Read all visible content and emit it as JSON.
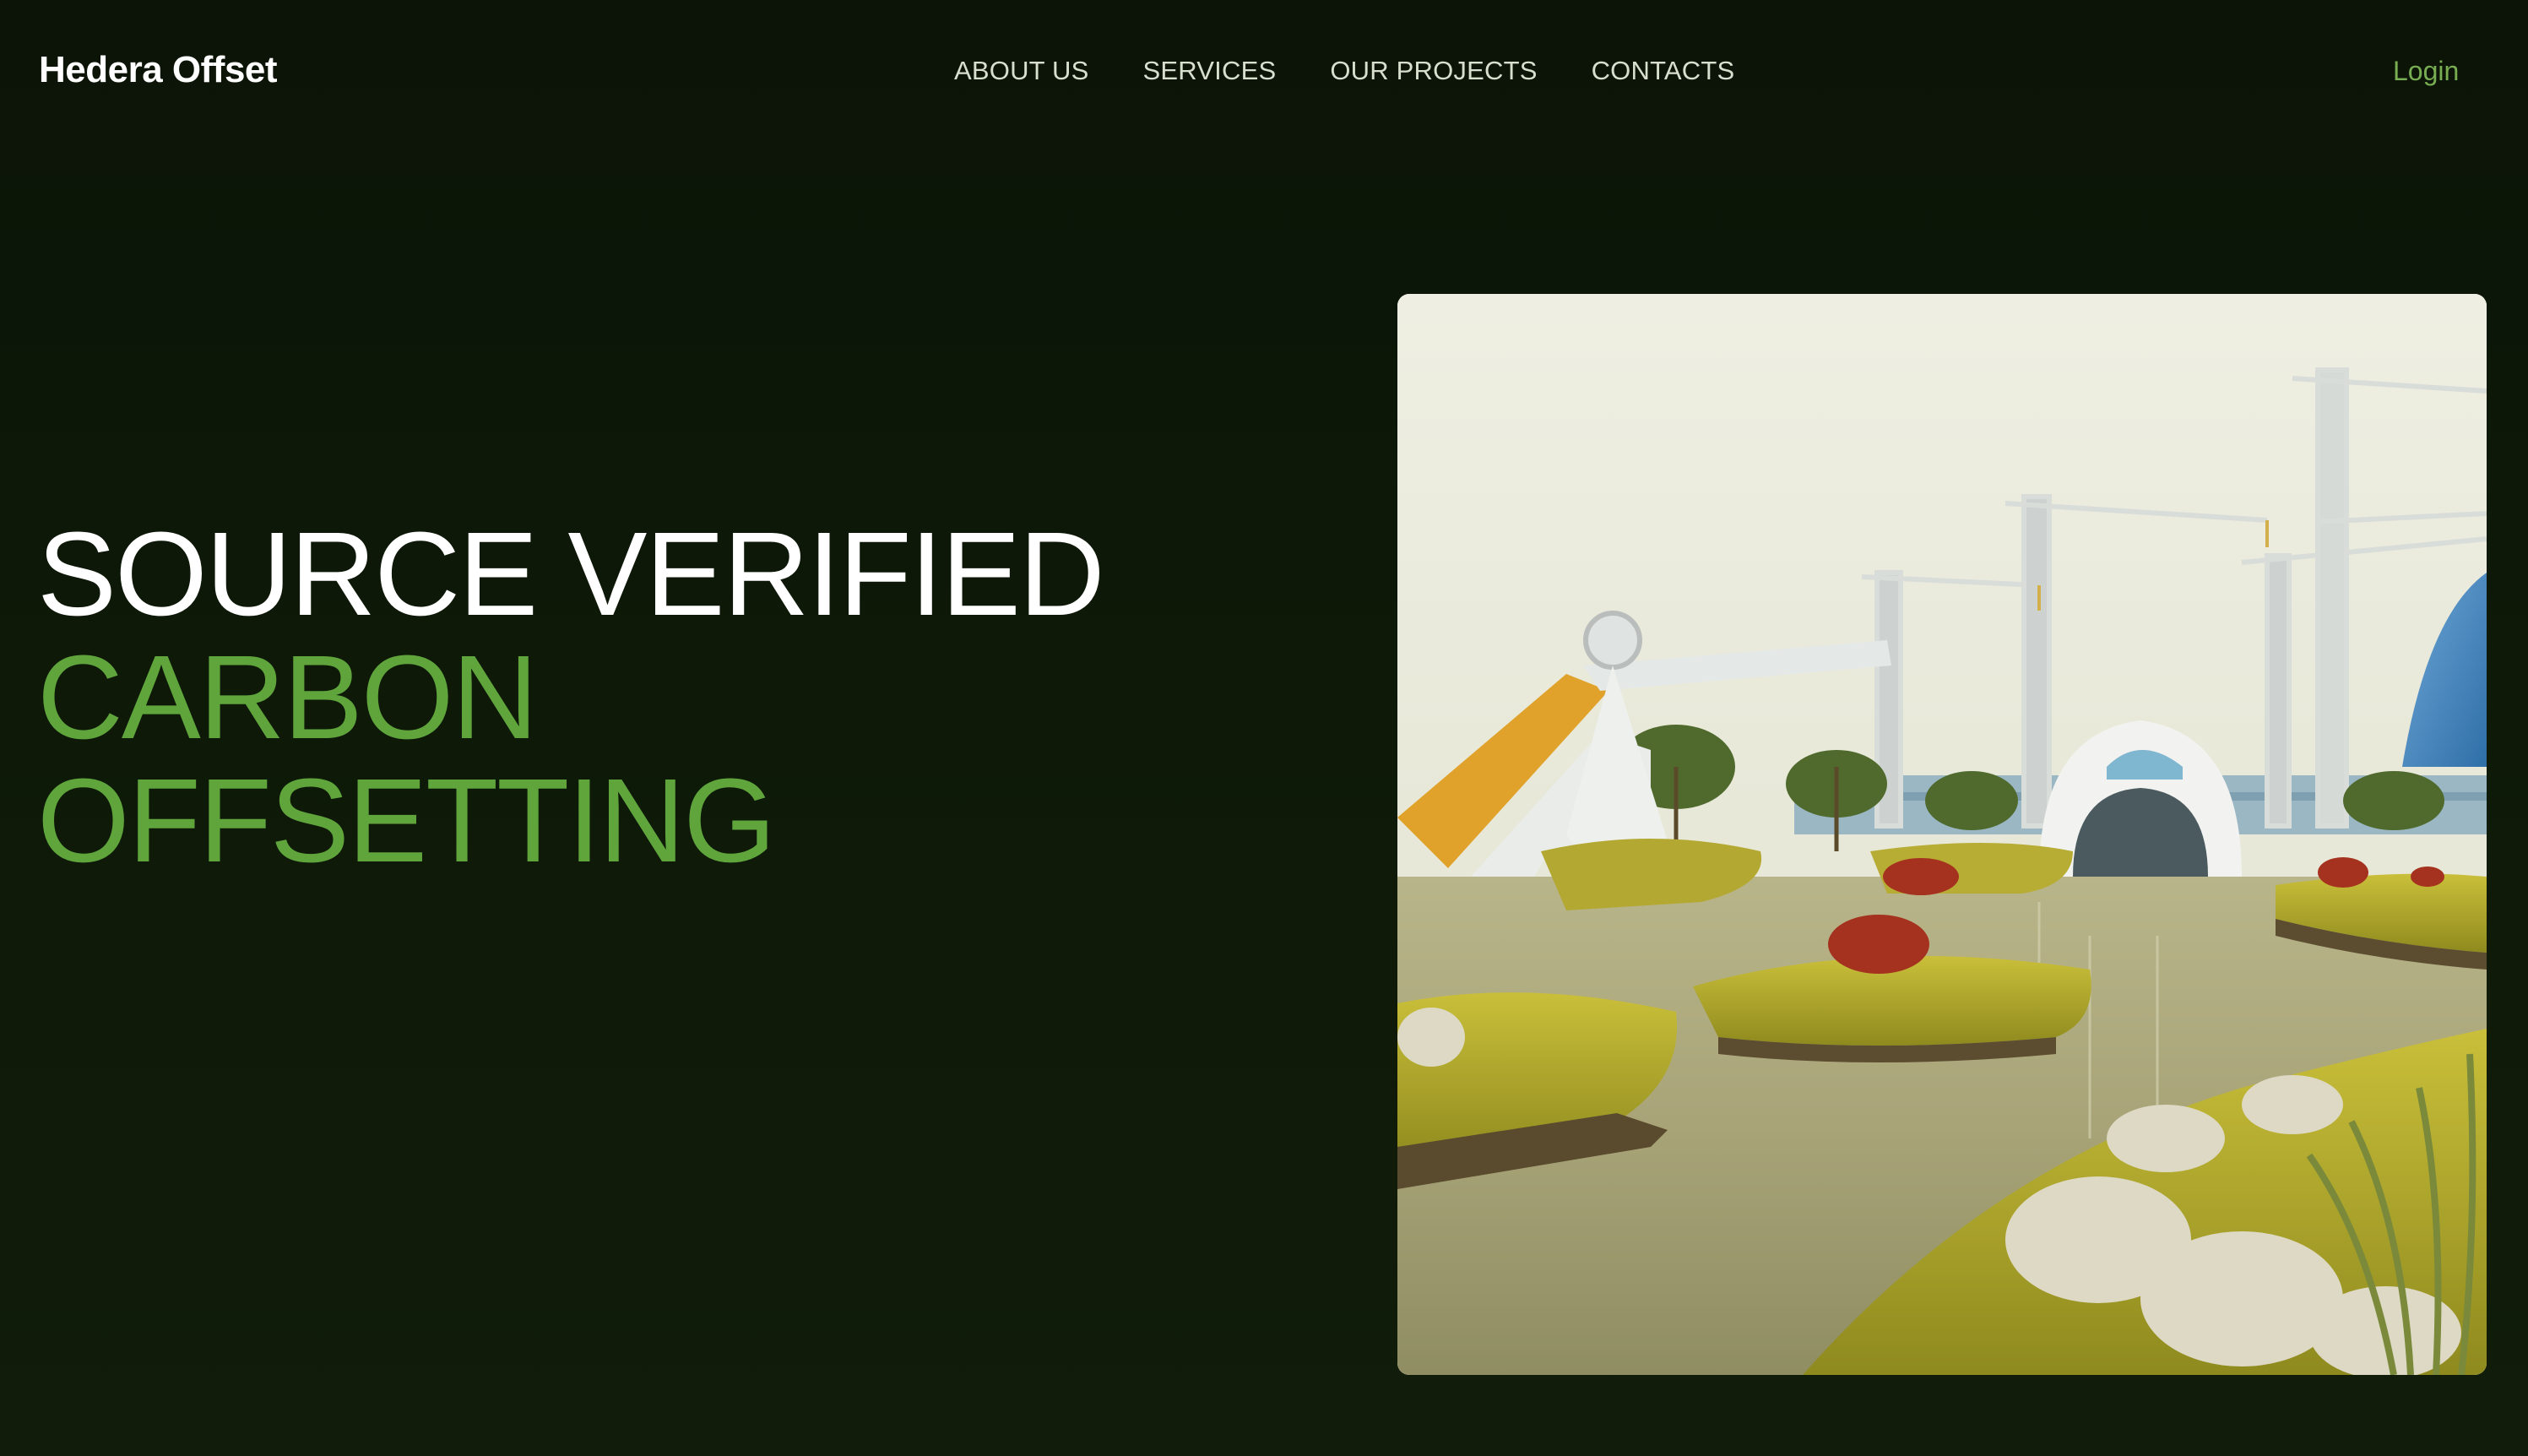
{
  "brand": {
    "name": "Hedera Offset"
  },
  "nav": {
    "items": [
      {
        "label": "ABOUT US"
      },
      {
        "label": "SERVICES"
      },
      {
        "label": "OUR PROJECTS"
      },
      {
        "label": "CONTACTS"
      }
    ]
  },
  "header": {
    "login_label": "Login"
  },
  "hero": {
    "line1": "SOURCE VERIFIED",
    "line2": "CARBON",
    "line3": "OFFSETTING"
  },
  "colors": {
    "background": "#0e1908",
    "accent_green": "#5fa53c",
    "login_green": "#78ad52",
    "nav_text": "#d9dfcf"
  }
}
